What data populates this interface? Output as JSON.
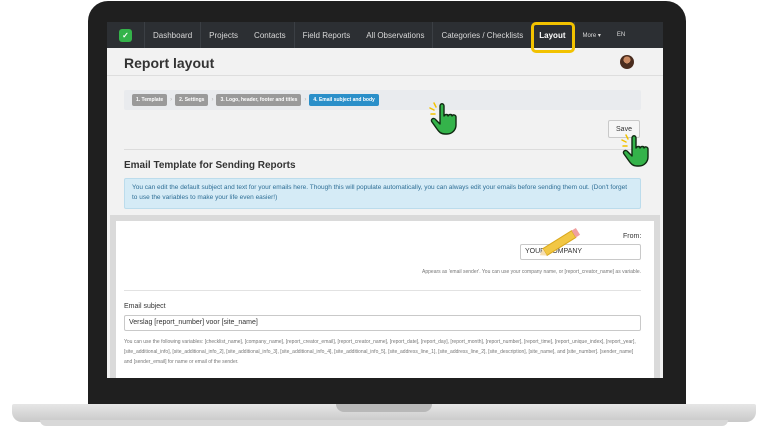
{
  "nav": {
    "logo": "✓",
    "items": [
      "Dashboard",
      "Projects",
      "Contacts",
      "Field Reports",
      "All Observations",
      "Categories / Checklists",
      "Layout",
      "More ▾",
      "EN"
    ]
  },
  "page": {
    "title": "Report layout"
  },
  "steps": [
    "1. Template",
    "2. Settings",
    "3. Logo, header, footer and titles",
    "4. Email subject and body"
  ],
  "save_label": "Save",
  "section": {
    "title": "Email Template for Sending Reports",
    "info": "You can edit the default subject and text for your emails here. Though this will populate automatically, you can always edit your emails before sending them out. (Don't forget to use the variables to make your life even easier!)"
  },
  "from": {
    "label": "From:",
    "value": "YOUR COMPANY",
    "help": "Appears as 'email sender'. You can use your company name, or [report_creator_name] as variable."
  },
  "subject": {
    "label": "Email subject",
    "value": "Verslag [report_number] voor [site_name]",
    "help": "You can use the following variables: [checklist_name], [company_name], [report_creator_email], [report_creator_name], [report_date], [report_day], [report_month], [report_number], [report_time], [report_unique_index], [report_year], [site_additional_info], [site_additional_info_2], [site_additional_info_3], [site_additional_info_4], [site_additional_info_5], [site_address_line_1], [site_address_line_2], [site_description], [site_name], and [site_number]. [sender_name] and [sender_email] for name or email of the sender."
  },
  "colors": {
    "highlight": "#f2c200",
    "accent": "#2a8fc9",
    "cursor": "#34b34a",
    "pencil": "#f2c744"
  }
}
